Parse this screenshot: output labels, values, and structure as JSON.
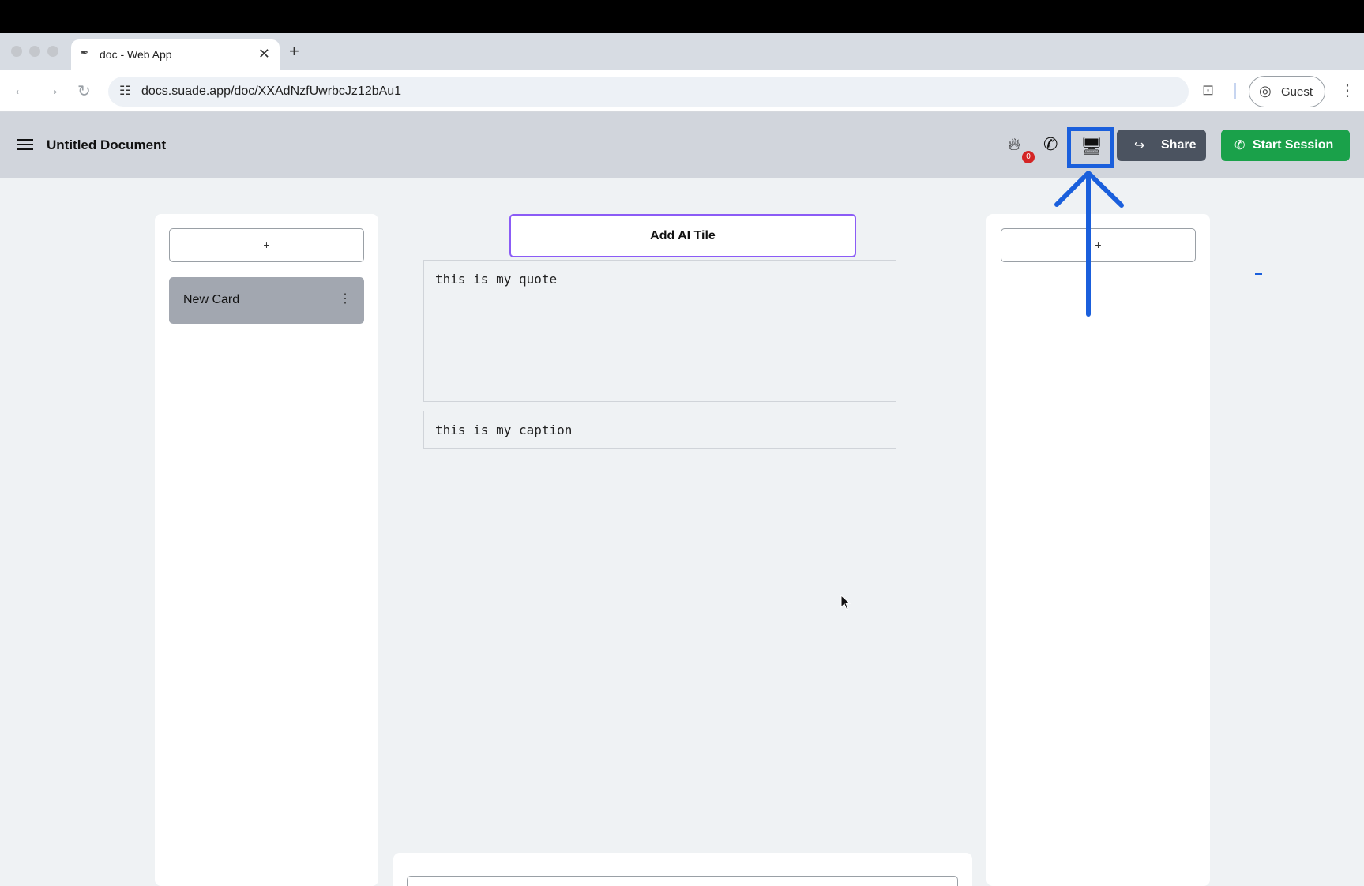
{
  "browser": {
    "tab_title": "doc - Web App",
    "tab_favicon": "feather-icon",
    "new_tab_symbol": "+",
    "close_symbol": "✕",
    "url": "docs.suade.app/doc/XXAdNzfUwrbcJz12bAu1",
    "profile_label": "Guest"
  },
  "header": {
    "title": "Untitled Document",
    "notification_count": "0",
    "share_label": "Share",
    "session_label": "Start Session"
  },
  "left_column": {
    "add_symbol": "+",
    "cards": [
      {
        "title": "New Card"
      }
    ]
  },
  "center": {
    "ai_tile_label": "Add AI Tile",
    "quote_text": "this is my quote",
    "caption_text": "this is my caption"
  },
  "right_column": {
    "add_symbol": "+"
  },
  "colors": {
    "highlight": "#1a5fdc",
    "share_bg": "#4b5360",
    "session_bg": "#1aa14a",
    "ai_tile_border": "#8b5cf6",
    "badge": "#d42525"
  }
}
